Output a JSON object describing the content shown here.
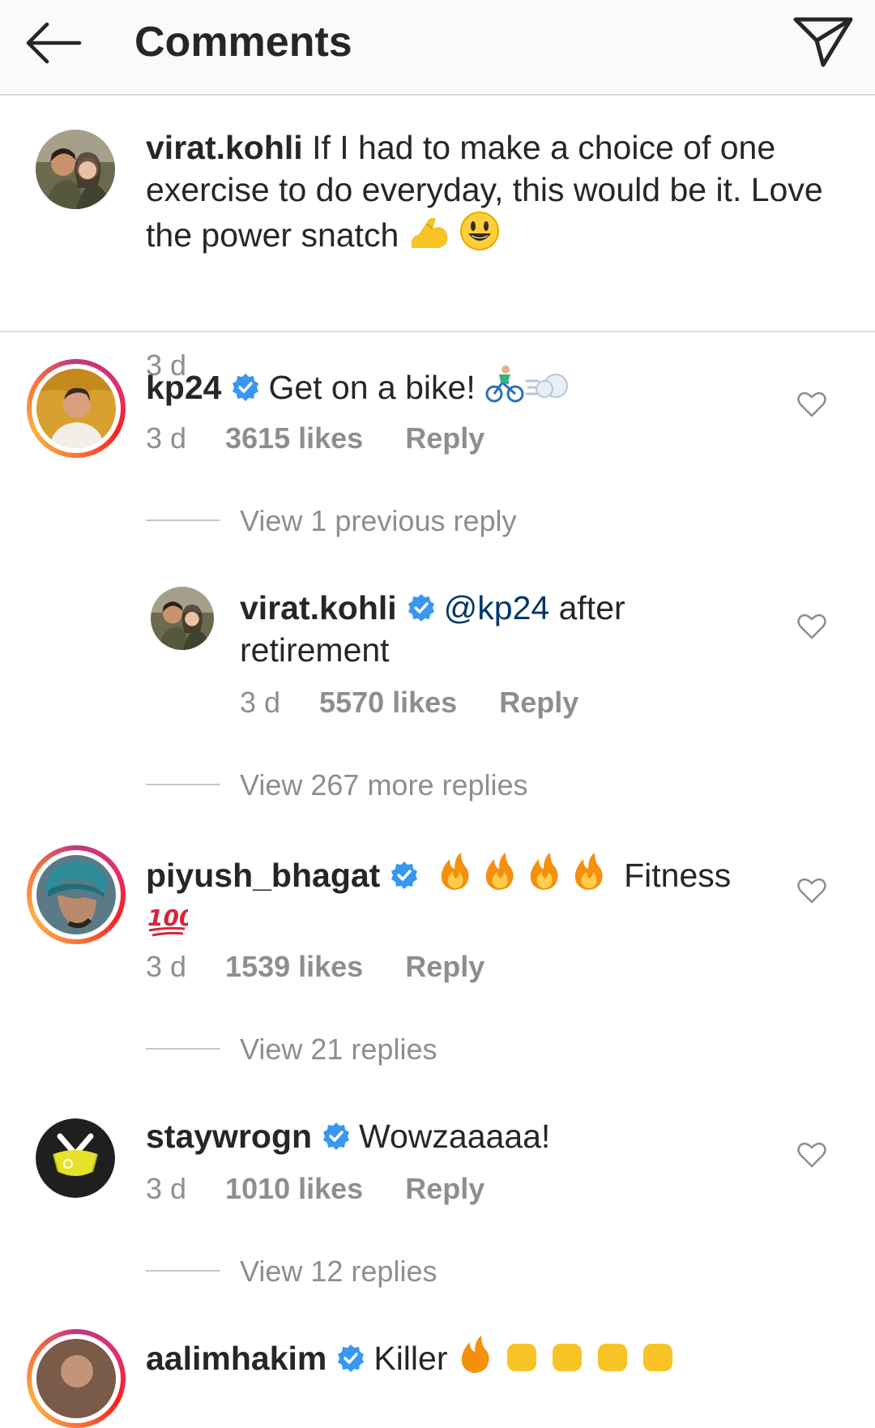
{
  "header": {
    "title": "Comments"
  },
  "caption": {
    "username": "virat.kohli",
    "text": "If I had to make a choice of one exercise to do everyday, this would be it. Love the power snatch",
    "time": "3 d"
  },
  "comments": [
    {
      "username": "kp24",
      "text": "Get on a bike!",
      "time": "3 d",
      "likes": "3615 likes",
      "reply": "Reply",
      "view_replies": "View 1 previous reply"
    },
    {
      "username": "virat.kohli",
      "mention": "@kp24",
      "text": "after retirement",
      "time": "3 d",
      "likes": "5570 likes",
      "reply": "Reply",
      "view_replies": "View 267 more replies"
    },
    {
      "username": "piyush_bhagat",
      "text": "Fitness",
      "time": "3 d",
      "likes": "1539 likes",
      "reply": "Reply",
      "view_replies": "View 21 replies"
    },
    {
      "username": "staywrogn",
      "text": "Wowzaaaaa!",
      "time": "3 d",
      "likes": "1010 likes",
      "reply": "Reply",
      "view_replies": "View 12 replies"
    },
    {
      "username": "aalimhakim",
      "text": "Killer"
    }
  ],
  "colors": {
    "verified": "#3897f0",
    "mention": "#00376b",
    "muted": "#8e8e8e"
  },
  "icons": [
    "back-arrow-icon",
    "direct-share-icon",
    "heart-icon",
    "verified-badge-icon"
  ]
}
